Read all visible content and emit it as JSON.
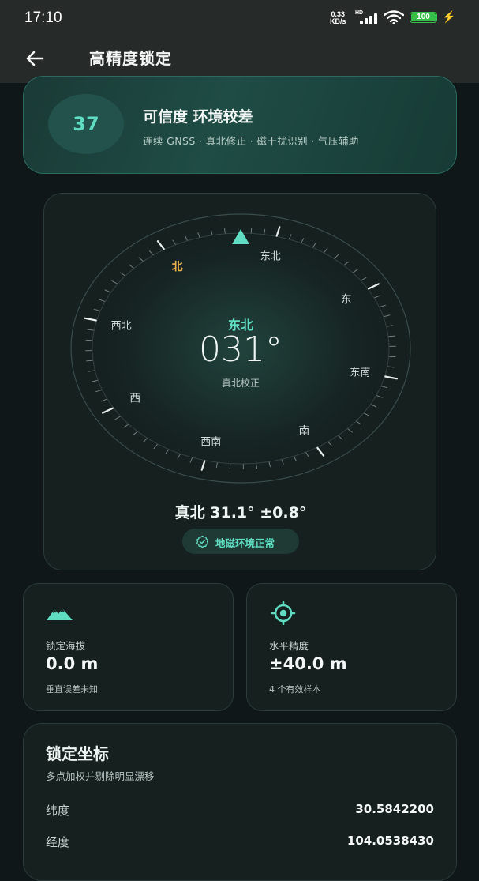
{
  "status_bar": {
    "time": "17:10",
    "net_rate_value": "0.33",
    "net_rate_unit": "KB/s",
    "network_label": "HD",
    "battery": "100",
    "battery_color": "#36c04a"
  },
  "app_bar": {
    "title": "高精度锁定",
    "back_icon": "arrow-left-icon"
  },
  "confidence": {
    "score": "37",
    "headline": "可信度 环境较差",
    "sources": "连续 GNSS · 真北修正 · 磁干扰识别 · 气压辅助"
  },
  "compass": {
    "direction_labels": {
      "n": "北",
      "ne": "东北",
      "e": "东",
      "se": "东南",
      "s": "南",
      "sw": "西南",
      "w": "西",
      "nw": "西北"
    },
    "current_direction": "东北",
    "heading": "031°",
    "heading_note": "真北校正",
    "true_north_reading": "真北 31.1° ±0.8°",
    "environment_status": "地磁环境正常",
    "heading_degrees": 31,
    "accent_color": "#5fdcc1",
    "north_color": "#e8b44c"
  },
  "altitude": {
    "icon": "mountain-icon",
    "label": "锁定海拔",
    "value": "0.0 m",
    "note": "垂直误差未知"
  },
  "accuracy": {
    "icon": "crosshair-target-icon",
    "label": "水平精度",
    "value": "±40.0 m",
    "note": "4 个有效样本"
  },
  "coordinates": {
    "title": "锁定坐标",
    "subtitle": "多点加权并剔除明显漂移",
    "rows": [
      {
        "label": "纬度",
        "value": "30.5842200"
      },
      {
        "label": "经度",
        "value": "104.0538430"
      }
    ]
  }
}
